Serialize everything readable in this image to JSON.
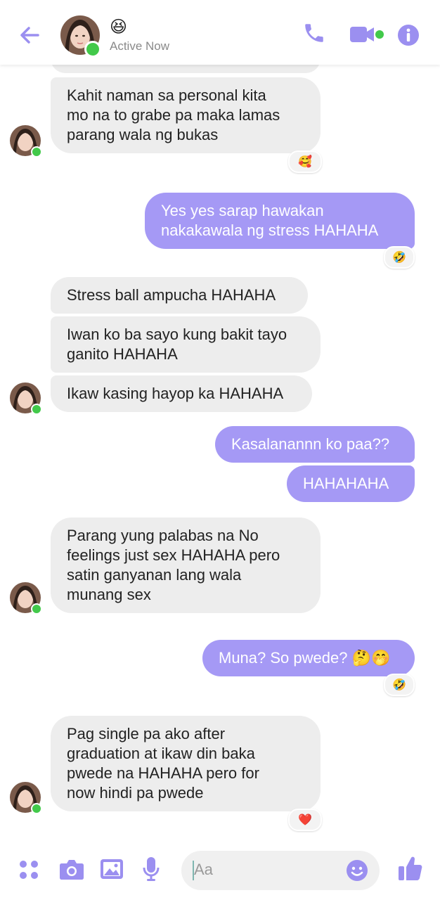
{
  "header": {
    "status_emoji": "😆",
    "status_text": "Active Now"
  },
  "messages": [
    {
      "id": "m1",
      "dir": "in",
      "lines": [
        "Kahit naman sa personal kita",
        "mo na to grabe pa maka lamas",
        "parang wala ng bukas"
      ],
      "reaction": "🥰"
    },
    {
      "id": "m2",
      "dir": "out",
      "lines": [
        "Yes yes sarap hawakan",
        "nakakawala ng stress HAHAHA"
      ],
      "reaction": "🤣"
    },
    {
      "id": "m3",
      "dir": "in",
      "lines": [
        "Stress ball ampucha HAHAHA"
      ]
    },
    {
      "id": "m4",
      "dir": "in",
      "lines": [
        "Iwan ko ba sayo kung bakit tayo",
        "ganito HAHAHA"
      ]
    },
    {
      "id": "m5",
      "dir": "in",
      "lines": [
        "Ikaw kasing hayop ka HAHAHA"
      ]
    },
    {
      "id": "m6",
      "dir": "out",
      "lines": [
        "Kasalanannn ko paa??"
      ]
    },
    {
      "id": "m7",
      "dir": "out",
      "lines": [
        "HAHAHAHA"
      ]
    },
    {
      "id": "m8",
      "dir": "in",
      "lines": [
        "Parang yung palabas na No",
        "feelings just sex HAHAHA pero",
        "satin ganyanan lang wala",
        "munang sex"
      ]
    },
    {
      "id": "m9",
      "dir": "out",
      "lines": [
        "Muna? So pwede? 🤔🤭"
      ],
      "reaction": "🤣"
    },
    {
      "id": "m10",
      "dir": "in",
      "lines": [
        "Pag single pa ako after",
        "graduation at ikaw din baka",
        "pwede na HAHAHA pero for",
        "now hindi pa pwede"
      ],
      "reaction": "❤️"
    }
  ],
  "composer": {
    "placeholder": "Aa"
  },
  "colors": {
    "accent": "#9b8ff0",
    "sent_bubble": "#a599f5",
    "received_bubble": "#ededed",
    "online": "#42c94a"
  },
  "icons": [
    "back-arrow-icon",
    "phone-icon",
    "video-camera-icon",
    "info-icon",
    "apps-icon",
    "camera-icon",
    "gallery-icon",
    "microphone-icon",
    "emoji-icon",
    "thumbs-up-icon"
  ]
}
